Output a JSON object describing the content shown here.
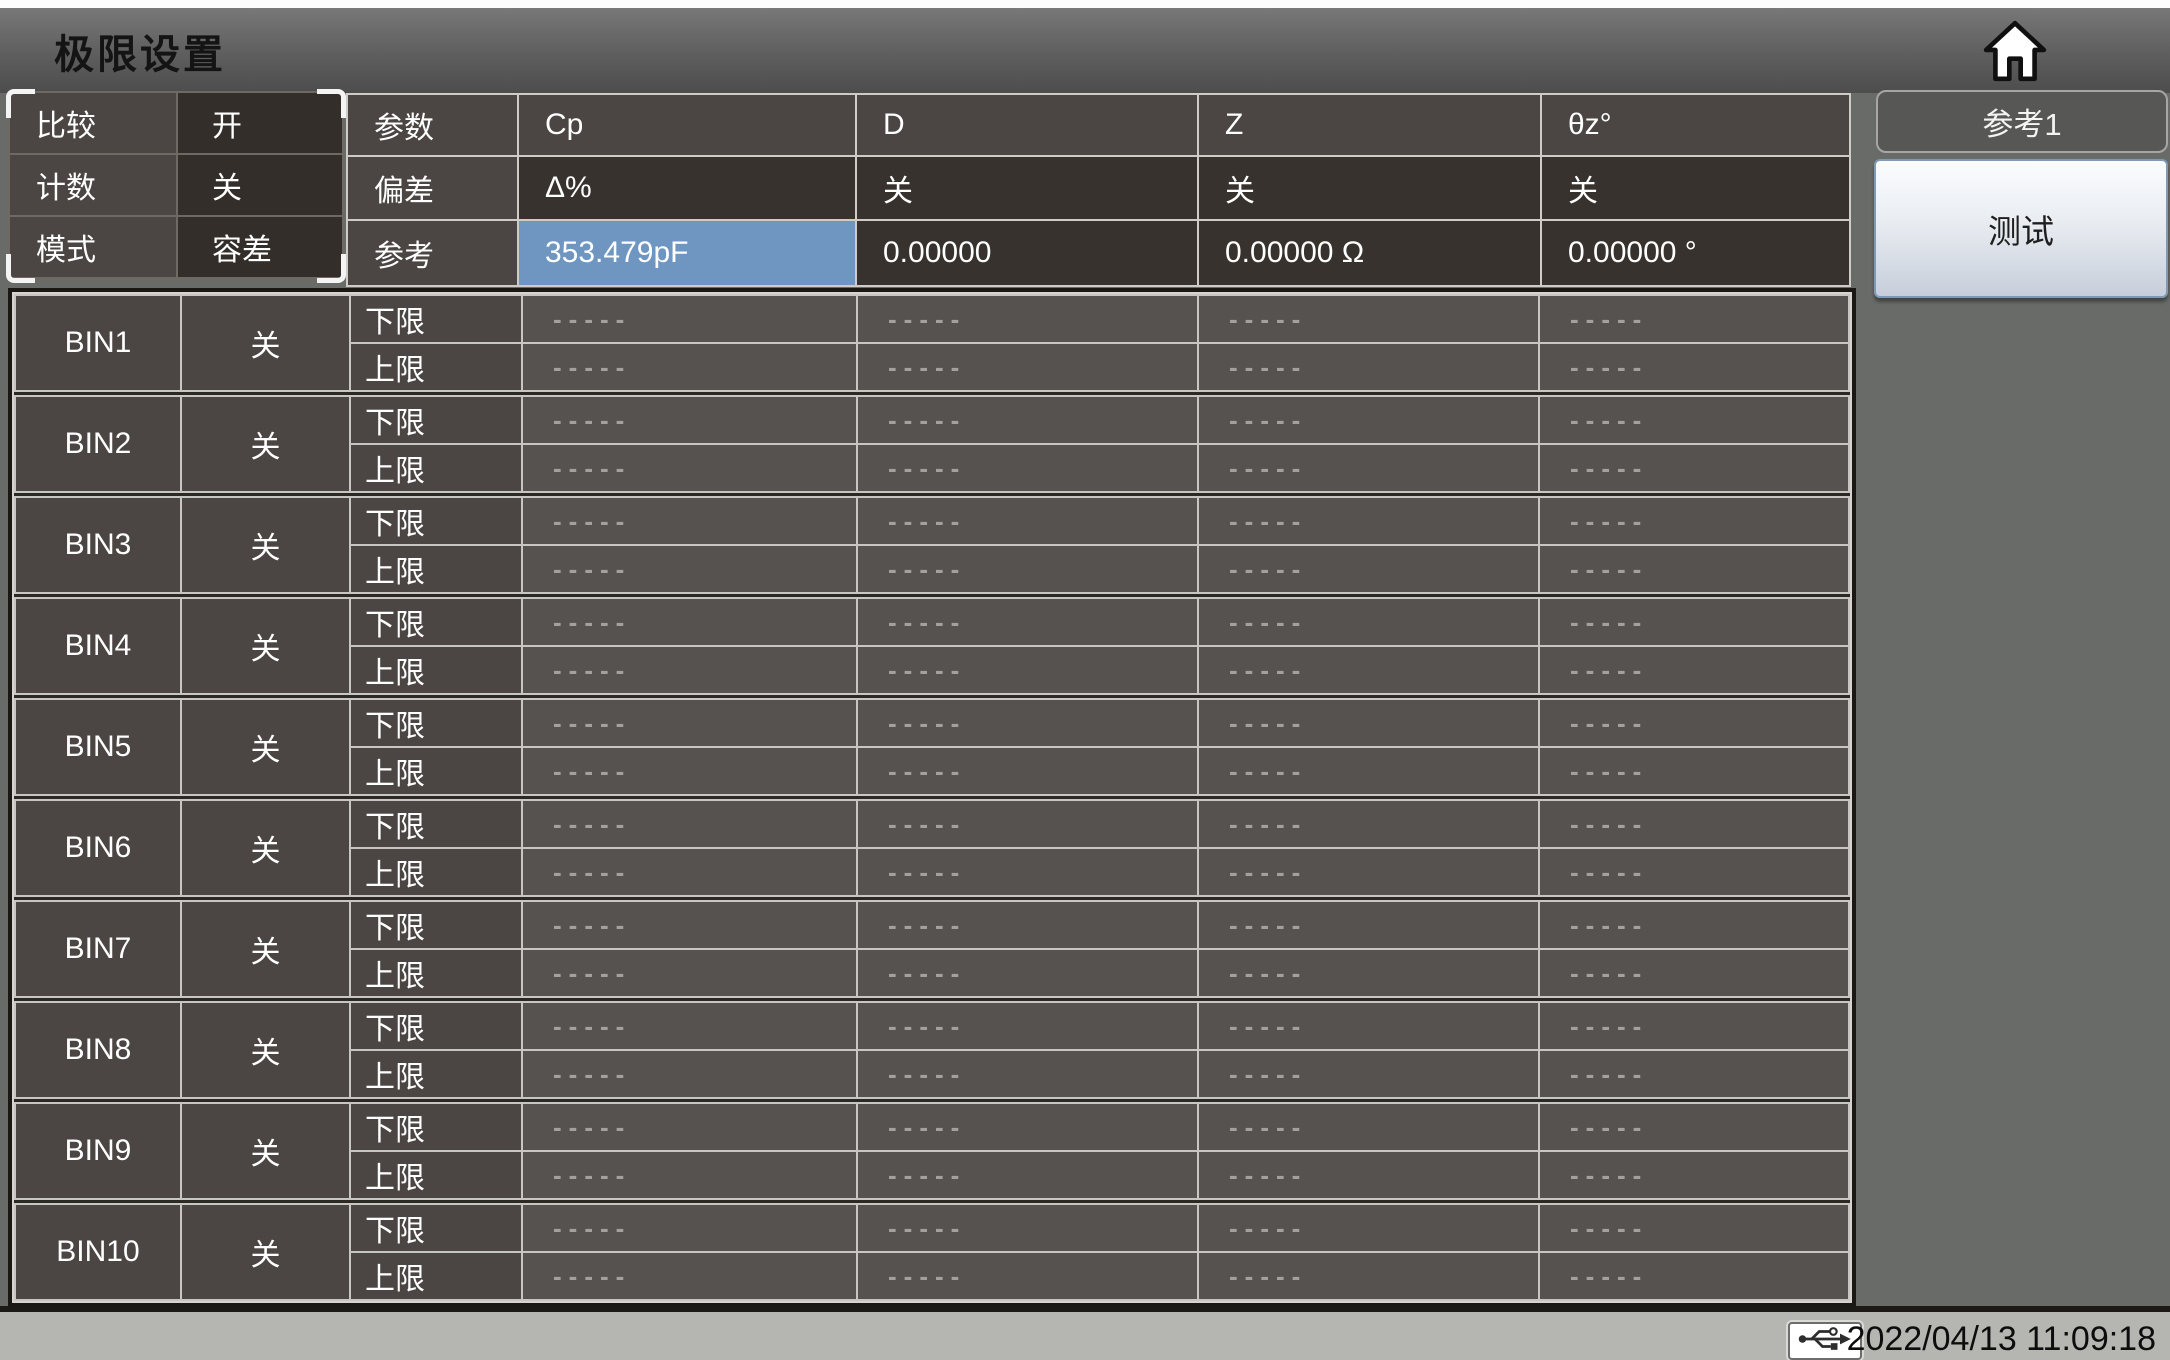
{
  "title": "极限设置",
  "topbar": {
    "home_icon": "home-icon"
  },
  "settings": {
    "rows": [
      {
        "label": "比较",
        "value": "开"
      },
      {
        "label": "计数",
        "value": "关"
      },
      {
        "label": "模式",
        "value": "容差"
      }
    ]
  },
  "param_table": {
    "rows": [
      {
        "label": "参数",
        "values": [
          "Cp",
          "D",
          "Z",
          "θz°"
        ]
      },
      {
        "label": "偏差",
        "values": [
          "Δ%",
          "关",
          "关",
          "关"
        ]
      },
      {
        "label": "参考",
        "values": [
          "353.479pF",
          "0.00000",
          "0.00000 Ω",
          "0.00000 °"
        ],
        "highlighted_index": 0
      }
    ]
  },
  "side_buttons": [
    {
      "label": "参考1"
    },
    {
      "label": "测试"
    }
  ],
  "bin_table": {
    "limit_row_labels": [
      "下限",
      "上限"
    ],
    "empty_value": "-----",
    "bins": [
      {
        "name": "BIN1",
        "state": "关"
      },
      {
        "name": "BIN2",
        "state": "关"
      },
      {
        "name": "BIN3",
        "state": "关"
      },
      {
        "name": "BIN4",
        "state": "关"
      },
      {
        "name": "BIN5",
        "state": "关"
      },
      {
        "name": "BIN6",
        "state": "关"
      },
      {
        "name": "BIN7",
        "state": "关"
      },
      {
        "name": "BIN8",
        "state": "关"
      },
      {
        "name": "BIN9",
        "state": "关"
      },
      {
        "name": "BIN10",
        "state": "关"
      }
    ]
  },
  "status_bar": {
    "usb_icon": "usb-icon",
    "datetime": "2022/04/13 11:09:18"
  },
  "colors": {
    "accent_blue": "#6e96c0",
    "cell_label": "#4b4643",
    "cell_dark": "#37322d",
    "cell_value": "#555250",
    "page_bg": "#696b68",
    "status_bg": "#b5b5b2"
  }
}
